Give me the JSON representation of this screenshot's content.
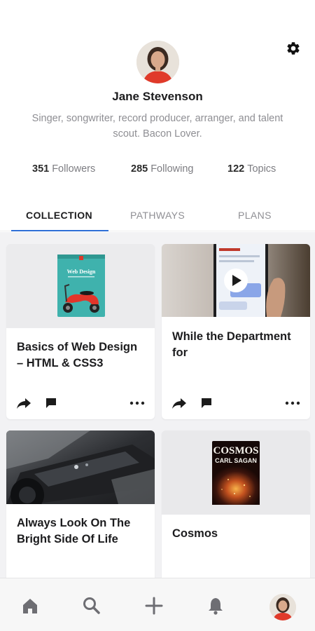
{
  "profile": {
    "name": "Jane Stevenson",
    "bio": "Singer, songwriter, record producer, arranger, and talent scout. Bacon Lover.",
    "stats": {
      "followers": {
        "count": "351",
        "label": "Followers"
      },
      "following": {
        "count": "285",
        "label": "Following"
      },
      "topics": {
        "count": "122",
        "label": "Topics"
      }
    }
  },
  "tabs": {
    "collection": "COLLECTION",
    "pathways": "PATHWAYS",
    "plans": "PLANS",
    "active": "collection"
  },
  "cards": [
    {
      "title": "Basics of Web Design – HTML & CSS3",
      "cover_text": "Web Design",
      "thumb": "book-cover"
    },
    {
      "title": "While the Department for",
      "thumb": "video",
      "icon": "play-icon"
    },
    {
      "title": "Always Look On The Bright Side Of Life",
      "thumb": "photo"
    },
    {
      "title": "Cosmos",
      "cover_title": "COSMOS",
      "cover_author": "CARL SAGAN",
      "thumb": "book-cover"
    }
  ],
  "card_actions": [
    "share-icon",
    "comment-icon",
    "more-icon"
  ],
  "bottom_nav": [
    "home-icon",
    "search-icon",
    "add-icon",
    "bell-icon",
    "avatar"
  ],
  "colors": {
    "accent": "#2f6fd6",
    "text_primary": "#1c1c1e",
    "text_secondary": "#8e8e93",
    "grid_background": "#f2f2f4"
  }
}
